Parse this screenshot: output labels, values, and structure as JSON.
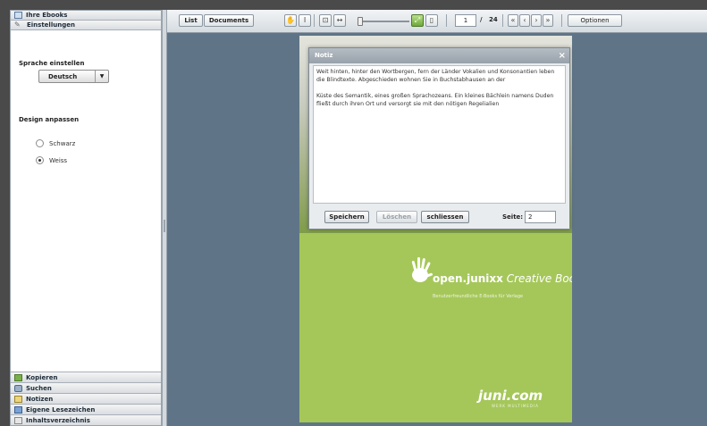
{
  "sidebar": {
    "top_items": [
      {
        "label": "Ihre Ebooks",
        "icon": "book-icon"
      },
      {
        "label": "Einstellungen",
        "icon": "pencil-icon"
      }
    ],
    "settings": {
      "language_title": "Sprache einstellen",
      "language_value": "Deutsch",
      "design_title": "Design anpassen",
      "design_options": [
        {
          "label": "Schwarz",
          "checked": false
        },
        {
          "label": "Weiss",
          "checked": true
        }
      ]
    },
    "bottom_items": [
      {
        "label": "Kopieren",
        "icon": "copy-icon"
      },
      {
        "label": "Suchen",
        "icon": "search-icon"
      },
      {
        "label": "Notizen",
        "icon": "note-icon"
      },
      {
        "label": "Eigene Lesezeichen",
        "icon": "bookmark-icon"
      },
      {
        "label": "Inhaltsverzeichnis",
        "icon": "toc-icon"
      }
    ]
  },
  "toolbar": {
    "list_label": "List",
    "documents_label": "Documents",
    "current_page": "1",
    "page_separator": "/",
    "total_pages": "24",
    "options_label": "Optionen"
  },
  "note_dialog": {
    "title": "Notiz",
    "close_glyph": "×",
    "paragraphs": [
      "Weit hinten, hinter den Wortbergen, fern der Länder Vokalien und Konsonantien leben die Blindtexte. Abgeschieden wohnen Sie in Buchstabhausen an der",
      "Küste des Semantik, eines großen Sprachozeans. Ein kleines Bächlein namens Duden fließt durch ihren Ort und versorgt sie mit den nötigen Regelialien"
    ],
    "save_label": "Speichern",
    "delete_label": "Löschen",
    "close_label": "schliessen",
    "page_label": "Seite:",
    "page_value": "2"
  },
  "book_page": {
    "brand_bold": "open.junixx",
    "brand_italic": "Creative Books",
    "tagline": "Benutzerfreundliche E-Books für Verlage",
    "publisher": "juni.com",
    "publisher_sub": "WERK MULTIMEDIA"
  },
  "colors": {
    "page_green": "#a5c75a",
    "viewer_background": "#5f7587"
  }
}
